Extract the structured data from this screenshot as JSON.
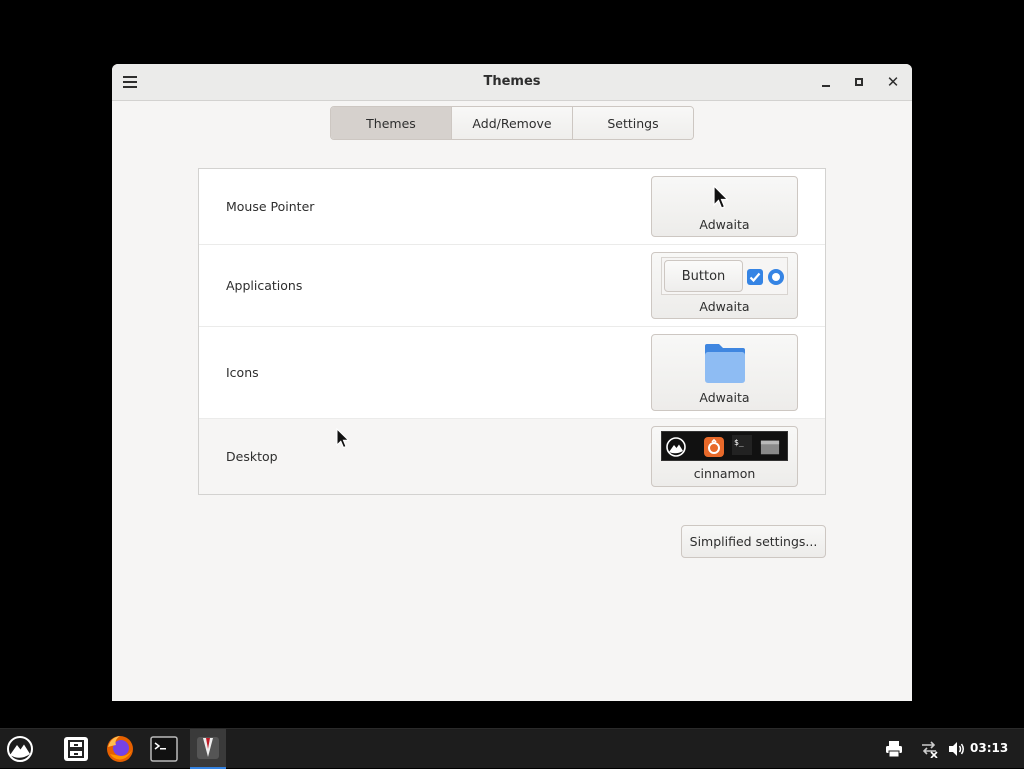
{
  "window": {
    "title": "Themes",
    "menu_icon": "hamburger-menu-icon",
    "controls": [
      "minimize-icon",
      "maximize-icon",
      "close-icon"
    ],
    "close_glyph": "✕"
  },
  "tabs": [
    {
      "label": "Themes",
      "active": true
    },
    {
      "label": "Add/Remove",
      "active": false
    },
    {
      "label": "Settings",
      "active": false
    }
  ],
  "themes": [
    {
      "label": "Mouse Pointer",
      "value": "Adwaita",
      "preview": "mouse-pointer-preview"
    },
    {
      "label": "Applications",
      "value": "Adwaita",
      "preview": "application-widgets-preview",
      "preview_button": "Button"
    },
    {
      "label": "Icons",
      "value": "Adwaita",
      "preview": "folder-icon"
    },
    {
      "label": "Desktop",
      "value": "cinnamon",
      "preview": "desktop-panel-preview"
    }
  ],
  "simplified_button": "Simplified settings...",
  "taskbar": {
    "menu_icon": "cinnamon-menu-icon",
    "launchers": [
      "file-manager-icon",
      "firefox-icon",
      "terminal-icon",
      "themes-settings-icon"
    ],
    "tray": [
      "printer-icon",
      "network-disconnected-icon",
      "volume-icon"
    ],
    "clock": "03:13"
  },
  "colors": {
    "accent": "#3584e4",
    "folder": "#7fb3f0",
    "firefox": "#e66000",
    "panel": "#1d1d1d"
  }
}
